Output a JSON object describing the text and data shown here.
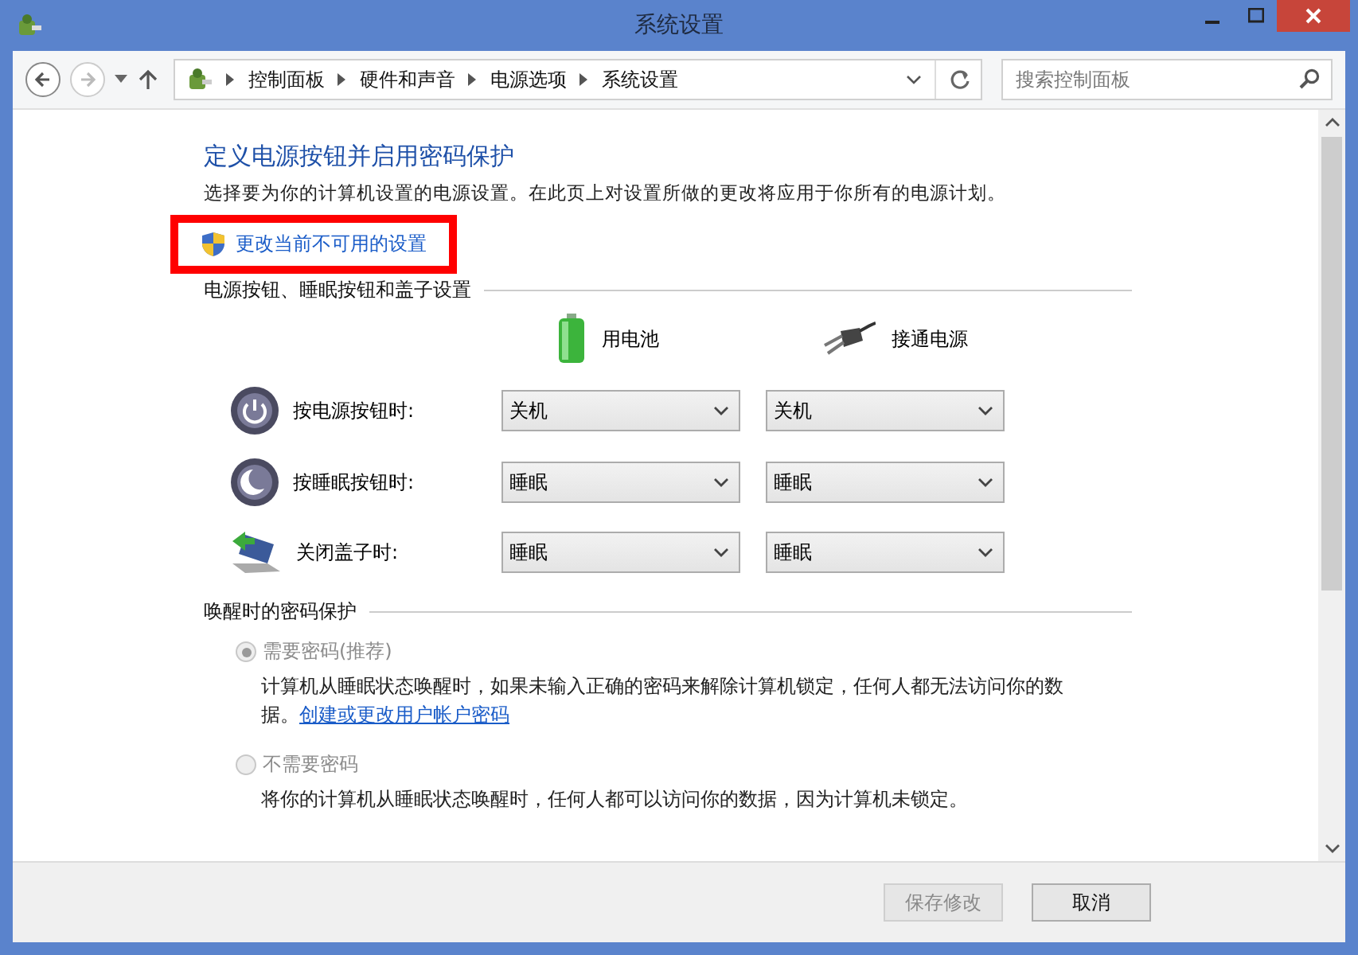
{
  "window": {
    "title": "系统设置"
  },
  "nav": {
    "back_disabled": false,
    "forward_disabled": true
  },
  "breadcrumb": [
    "控制面板",
    "硬件和声音",
    "电源选项",
    "系统设置"
  ],
  "search": {
    "placeholder": "搜索控制面板"
  },
  "heading": "定义电源按钮并启用密码保护",
  "intro": "选择要为你的计算机设置的电源设置。在此页上对设置所做的更改将应用于你所有的电源计划。",
  "admin_link": {
    "label": "更改当前不可用的设置",
    "highlighted": true
  },
  "power_section": {
    "title": "电源按钮、睡眠按钮和盖子设置",
    "columns": [
      {
        "kind": "battery",
        "label": "用电池"
      },
      {
        "kind": "plug",
        "label": "接通电源"
      }
    ],
    "rows": [
      {
        "kind": "power",
        "label": "按电源按钮时:",
        "values": [
          "关机",
          "关机"
        ]
      },
      {
        "kind": "sleep",
        "label": "按睡眠按钮时:",
        "values": [
          "睡眠",
          "睡眠"
        ]
      },
      {
        "kind": "lid",
        "label": "关闭盖子时:",
        "values": [
          "睡眠",
          "睡眠"
        ]
      }
    ]
  },
  "password_section": {
    "title": "唤醒时的密码保护",
    "disabled": true,
    "options": [
      {
        "label": "需要密码(推荐)",
        "selected": true,
        "description": "计算机从睡眠状态唤醒时，如果未输入正确的密码来解除计算机锁定，任何人都无法访问你的数据。",
        "link": "创建或更改用户帐户密码"
      },
      {
        "label": "不需要密码",
        "selected": false,
        "description": "将你的计算机从睡眠状态唤醒时，任何人都可以访问你的数据，因为计算机未锁定。"
      }
    ]
  },
  "buttons": [
    {
      "label": "保存修改",
      "disabled": true
    },
    {
      "label": "取消",
      "disabled": false
    }
  ]
}
